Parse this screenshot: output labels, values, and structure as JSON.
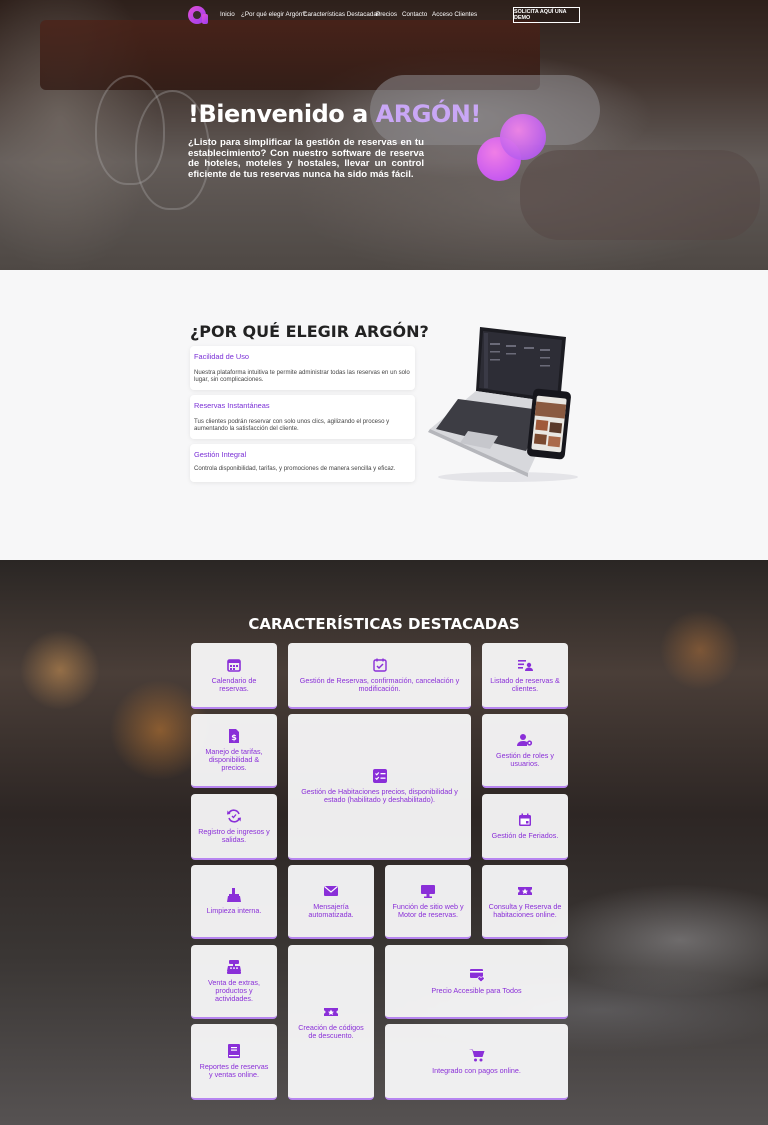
{
  "nav": {
    "links": [
      "Inicio",
      "¿Por qué elegir Argón?",
      "Características Destacadas",
      "Precios",
      "Contacto",
      "Acceso Clientes"
    ],
    "demo_button": "SOLICITA AQUÍ UNA DEMO"
  },
  "hero": {
    "title_prefix": "!Bienvenido a ",
    "title_brand": "ARGÓN!",
    "text": "¿Listo para simplificar la gestión de reservas en tu establecimiento? Con nuestro software de reserva de hoteles, moteles y hostales, llevar un control eficiente de tus reservas nunca ha sido más fácil."
  },
  "why": {
    "title": "¿POR QUÉ ELEGIR ARGÓN?",
    "cards": [
      {
        "title": "Facilidad de Uso",
        "text": "Nuestra plataforma intuitiva te permite administrar todas las reservas en un solo lugar, sin complicaciones."
      },
      {
        "title": "Reservas Instantáneas",
        "text": "Tus clientes podrán reservar con solo unos clics, agilizando el proceso y aumentando la satisfacción del cliente."
      },
      {
        "title": "Gestión Integral",
        "text": "Controla disponibilidad, tarifas, y promociones de manera sencilla y eficaz."
      }
    ]
  },
  "features": {
    "title": "CARACTERÍSTICAS DESTACADAS",
    "items": [
      {
        "label": "Calendario de reservas.",
        "icon": "calendar-icon"
      },
      {
        "label": "Gestión de Reservas, confirmación, cancelación y modificación.",
        "icon": "calendar-check-icon"
      },
      {
        "label": "Listado de reservas & clientes.",
        "icon": "user-list-icon"
      },
      {
        "label": "Manejo de tarifas, disponibilidad & precios.",
        "icon": "dollar-document-icon"
      },
      {
        "label": "Gestión de Habitaciones precios, disponibilidad y estado (habilitado y deshabilitado).",
        "icon": "checklist-icon"
      },
      {
        "label": "Gestión de roles y usuarios.",
        "icon": "user-gear-icon"
      },
      {
        "label": "Registro de ingresos y salidas.",
        "icon": "sync-icon"
      },
      {
        "label": "Gestión de Feriados.",
        "icon": "calendar-day-icon"
      },
      {
        "label": "Limpieza interna.",
        "icon": "broom-icon"
      },
      {
        "label": "Mensajería automatizada.",
        "icon": "envelope-icon"
      },
      {
        "label": "Función de sitio web y Motor de reservas.",
        "icon": "monitor-icon"
      },
      {
        "label": "Consulta y Reserva de habitaciones online.",
        "icon": "ticket-icon"
      },
      {
        "label": "Venta de extras, productos y actividades.",
        "icon": "cash-register-icon"
      },
      {
        "label": "Creación de códigos de descuento.",
        "icon": "coupon-icon"
      },
      {
        "label": "Precio Accesible para Todos",
        "icon": "card-heart-icon"
      },
      {
        "label": "Reportes de reservas y ventas online.",
        "icon": "report-book-icon"
      },
      {
        "label": "Integrado con pagos online.",
        "icon": "cart-icon"
      }
    ]
  },
  "colors": {
    "accent": "#8a2fd8",
    "brand_light": "#c9a7f6",
    "card_border": "#b785f0"
  }
}
